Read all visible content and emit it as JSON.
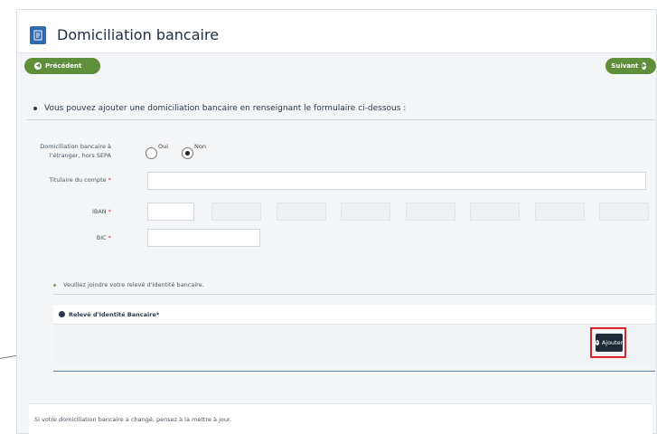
{
  "header": {
    "title": "Domiciliation bancaire"
  },
  "nav": {
    "prev_label": "Précédent",
    "next_label": "Suivant"
  },
  "form": {
    "intro": "Vous pouvez ajouter une domiciliation bancaire en renseignant le formulaire ci-dessous :",
    "foreign_label_line1": "Domiciliation bancaire à",
    "foreign_label_line2": "l'étranger, hors SEPA",
    "radio_yes": "Oui",
    "radio_no": "Non",
    "selected": "Non",
    "holder_label": "Titulaire du compte",
    "iban_label": "IBAN",
    "bic_label": "BIC",
    "required_marker": "*"
  },
  "attachment": {
    "instruction": "Veuillez joindre votre relevé d'identité bancaire.",
    "section_title": "Relevé d'Identité Bancaire*",
    "add_label": "Ajouter"
  },
  "footer": {
    "text": "Si votre domiciliation bancaire a changé, pensez à la mettre à jour."
  },
  "colors": {
    "primary_green": "#5f8f3a",
    "dark_button": "#1e2a35",
    "highlight_red": "#d9262b",
    "doc_icon_blue": "#2f6ab0"
  },
  "icons": {
    "header": "document-icon",
    "prev": "arrow-left-circle-icon",
    "next": "arrow-right-circle-icon",
    "section": "circle-icon",
    "add": "plus-circle-icon"
  }
}
